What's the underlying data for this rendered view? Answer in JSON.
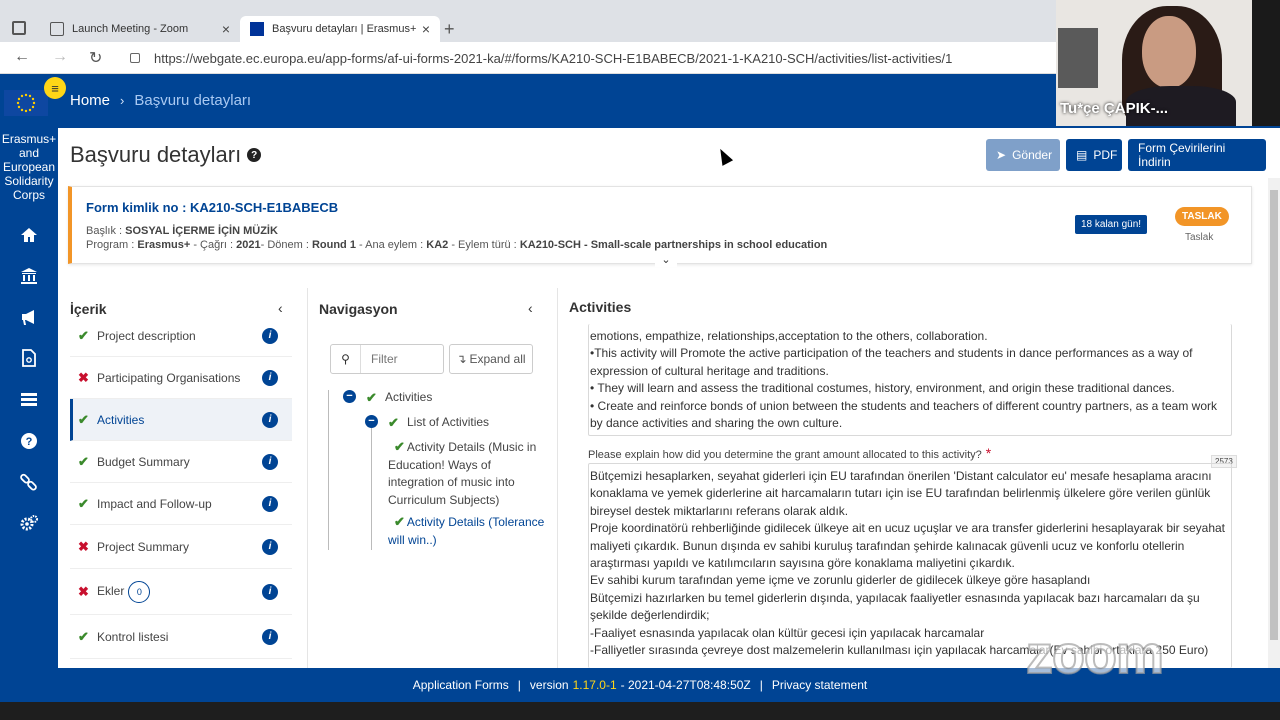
{
  "browser": {
    "tabs": [
      {
        "title": "Launch Meeting - Zoom"
      },
      {
        "title": "Başvuru detayları | Erasmus+ ve"
      }
    ],
    "url": "https://webgate.ec.europa.eu/app-forms/af-ui-forms-2021-ka/#/forms/KA210-SCH-E1BABECB/2021-1-KA210-SCH/activities/list-activities/1"
  },
  "header": {
    "breadcrumb_home": "Home",
    "breadcrumb_current": "Başvuru detayları"
  },
  "sidebar": {
    "org_name": "Erasmus+ and European Solidarity Corps",
    "icons": [
      "home-icon",
      "institution-icon",
      "megaphone-icon",
      "document-icon",
      "list-icon",
      "help-icon",
      "link-icon",
      "settings-icon"
    ]
  },
  "page": {
    "title": "Başvuru detayları",
    "buttons": {
      "send": "Gönder",
      "pdf": "PDF",
      "translations": "Form Çevirilerini İndirin"
    }
  },
  "form": {
    "id_label": "Form kimlik no : KA210-SCH-E1BABECB",
    "title_label": "Başlık : ",
    "title_value": "SOSYAL İÇERME İÇİN MÜZİK",
    "program_label": "Program : ",
    "program_value": "Erasmus+",
    "call_label": " - Çağrı : ",
    "call_value": "2021",
    "round_label": "- Dönem : ",
    "round_value": "Round 1",
    "action_label": " - Ana eylem : ",
    "action_value": "KA2",
    "action_type_label": " - Eylem türü : ",
    "action_type_value": "KA210-SCH - Small-scale partnerships in school education",
    "days_left": "18 kalan gün!",
    "status_badge": "TASLAK",
    "status_text": "Taslak"
  },
  "contents": {
    "header": "İçerik",
    "items": [
      {
        "label": "Project description",
        "status": "ok"
      },
      {
        "label": "Participating Organisations",
        "status": "error"
      },
      {
        "label": "Activities",
        "status": "ok",
        "active": true
      },
      {
        "label": "Budget Summary",
        "status": "ok"
      },
      {
        "label": "Impact and Follow-up",
        "status": "ok"
      },
      {
        "label": "Project Summary",
        "status": "error"
      },
      {
        "label": "Ekler",
        "status": "error",
        "count": "0"
      },
      {
        "label": "Kontrol listesi",
        "status": "ok"
      }
    ]
  },
  "navigation": {
    "header": "Navigasyon",
    "filter_placeholder": "Filter",
    "expand_all": "Expand all",
    "tree": {
      "activities": "Activities",
      "list": "List of Activities",
      "detail1": "Activity Details (Music in Education! Ways of integration of music into Curriculum Subjects)",
      "detail2": "Activity Details (Tolerance will win..)"
    }
  },
  "activities": {
    "header": "Activities",
    "upper_text": [
      "emotions, empathize, relationships,acceptation to the others, collaboration.",
      "•This activity will Promote the active participation of the teachers and students in dance performances as a way of expression of cultural heritage and traditions.",
      "• They will learn and assess the traditional costumes, history, environment, and origin these traditional dances.",
      "• Create and reinforce bonds of union between the students and teachers of different country partners, as a team work by dance activities and sharing the own culture."
    ],
    "question": "Please explain how did you determine the grant amount allocated to this activity?",
    "required_mark": "*",
    "char_count": "2573",
    "answer_text": [
      "Bütçemizi hesaplarken, seyahat giderleri için EU tarafından önerilen  'Distant calculator eu' mesafe hesaplama aracını konaklama ve yemek giderlerine ait  harcamaların tutarı için ise  EU tarafından belirlenmiş  ülkelere göre verilen  günlük bireysel destek miktarlarını referans olarak aldık.",
      "Proje koordinatörü rehberliğinde  gidilecek ülkeye ait en ucuz uçuşlar ve  ara transfer giderlerini hesaplayarak  bir seyahat maliyeti çıkardık. Bunun dışında ev sahibi kuruluş tarafından  şehirde kalınacak güvenli ucuz ve konforlu otellerin araştırması yapıldı ve katılımcıların sayısına göre konaklama maliyetini çıkardık.",
      "Ev sahibi kurum tarafından yeme içme ve zorunlu giderler de gidilecek ülkeye göre hasaplandı",
      "Bütçemizi hazırlarken bu temel giderlerin dışında, yapılacak faaliyetler esnasında yapılacak bazı harcamaları da  şu şekilde değerlendirdik;",
      "-Faaliyet esnasında yapılacak olan kültür gecesi için yapılacak harcamalar",
      "-Falliyetler sırasında çevreye dost malzemelerin kullanılması için yapılacak harcamalar(Ev sahibi ortaklara 250 Euro)"
    ]
  },
  "footer": {
    "app": "Application Forms",
    "version_label": "version",
    "version": "1.17.0-1",
    "build": "- 2021-04-27T08:48:50Z",
    "privacy": "Privacy statement"
  },
  "zoom": {
    "participant_name": "Tu*çe ÇAPIK-...",
    "watermark": "zoom"
  }
}
